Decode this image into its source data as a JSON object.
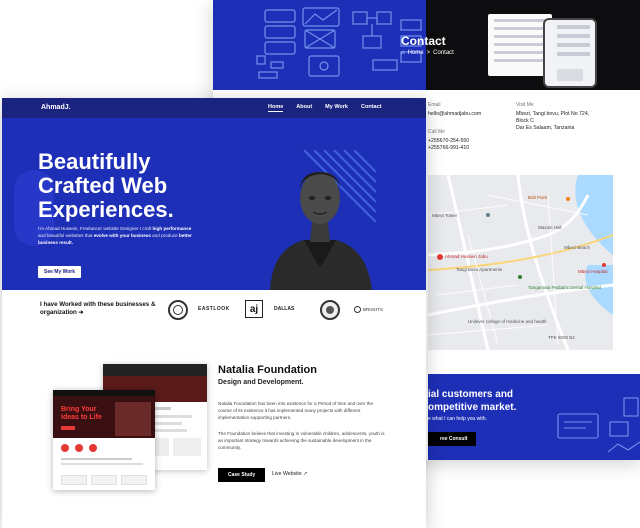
{
  "back_page": {
    "hero": {
      "title": "Contact",
      "breadcrumb_home": "Home",
      "breadcrumb_sep": ">",
      "breadcrumb_current": "Contact"
    },
    "info": {
      "email_label": "Email",
      "email_value": "hello@ahmadjabu.com",
      "call_label": "Call Me",
      "phone_1": "+255670-254-550",
      "phone_2": "+255766-991-410",
      "visit_label": "Visit Me",
      "address_1": "Mbezi, Tangi bovu, Plot No 724,",
      "address_2": "Block C",
      "address_3": "Dar Es Salaam, Tanzania"
    },
    "map": {
      "labels": [
        "Ahmad Hussein Jabu",
        "Tangi Bovu Apartments",
        "Mbezi Tower",
        "Bolt Point",
        "Maxain Hall",
        "Tangamata Pediatric Dental Hospital",
        "Unilever college of medicine and health",
        "TPK 6000 B2",
        "Mbezi Beach",
        "Mbezi Hospital"
      ]
    },
    "cta": {
      "title_line_1": "ial customers and",
      "title_line_2": "ompetitive market.",
      "subtitle": "e what I can help you with.",
      "button": "ree Consult"
    }
  },
  "front_page": {
    "nav": {
      "logo": "AhmadJ.",
      "links": [
        "Home",
        "About",
        "My Work",
        "Contact"
      ]
    },
    "hero": {
      "title_line_1": "Beautifully",
      "title_line_2": "Crafted Web",
      "title_line_3": "Experiences.",
      "desc_1": "I'm Ahmad Hussein, Freelancer website Designer I craft ",
      "desc_b1": "high performance",
      "desc_2": " and beautiful websites that ",
      "desc_b2": "evolve with your business",
      "desc_3": " and produce ",
      "desc_b3": "better business result.",
      "button": "See My Work"
    },
    "clients": {
      "text": "I have Worked with these businesses & organization",
      "arrow": "➔",
      "logos": [
        "seal-logo",
        "EASTLOOK",
        "aj",
        "DALLAS",
        "emblem-logo",
        "BRIGHTS"
      ]
    },
    "project": {
      "title": "Natalia Foundation",
      "subtitle": "Design and Development.",
      "paragraph_1": "Natalia Foundation has been into existence for a Period of time and over the course of its existence it has implemented many projects with different implementation supporting partners.",
      "paragraph_2": "The Foundation believe that investing in vulnerable children, adolescents, youth is an important strategy towards achieving the sustainable development in the community.",
      "case_button": "Case Study",
      "live_link": "Live Website",
      "mock_headline_1": "Bring Your",
      "mock_headline_2": "Ideas to Life"
    }
  },
  "colors": {
    "brand_blue": "#1e2fb7",
    "nav_blue": "#1a237e",
    "dark": "#0d0d0f",
    "black": "#000000",
    "white": "#ffffff"
  }
}
